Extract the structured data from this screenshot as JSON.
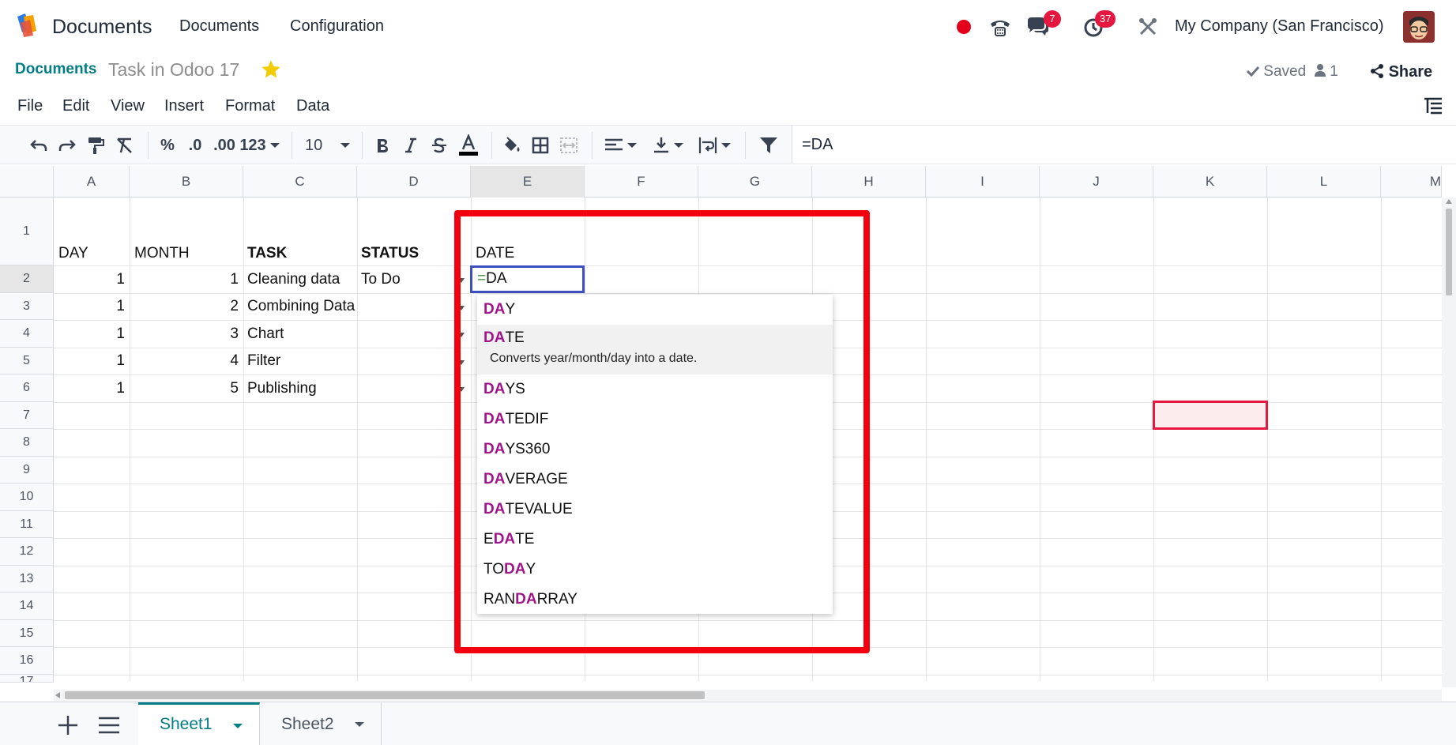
{
  "navbar": {
    "app_name": "Documents",
    "menu": [
      "Documents",
      "Configuration"
    ],
    "chat_badge": "7",
    "activity_badge": "37",
    "company": "My Company (San Francisco)"
  },
  "breadcrumb": {
    "parent": "Documents",
    "title": "Task in Odoo 17",
    "status": "Saved",
    "users": "1",
    "share": "Share"
  },
  "menubar": [
    "File",
    "Edit",
    "View",
    "Insert",
    "Format",
    "Data"
  ],
  "toolbar": {
    "percent": "%",
    "decrease_decimal": ".0",
    "increase_decimal": ".00",
    "number_format": "123",
    "font_size": "10",
    "formula_value": "=DA"
  },
  "columns": [
    "A",
    "B",
    "C",
    "D",
    "E",
    "F",
    "G",
    "H",
    "I",
    "J",
    "K",
    "L",
    "M"
  ],
  "rows": [
    "1",
    "2",
    "3",
    "4",
    "5",
    "6",
    "7",
    "8",
    "9",
    "10",
    "11",
    "12",
    "13",
    "14",
    "15",
    "16",
    "17"
  ],
  "cells": {
    "header": {
      "day": "DAY",
      "month": "MONTH",
      "task": "TASK",
      "status": "STATUS",
      "date": "DATE"
    },
    "data": [
      {
        "day": "1",
        "month": "1",
        "task": "Cleaning data",
        "status": "To Do"
      },
      {
        "day": "1",
        "month": "2",
        "task": "Combining Data",
        "status": ""
      },
      {
        "day": "1",
        "month": "3",
        "task": "Chart",
        "status": ""
      },
      {
        "day": "1",
        "month": "4",
        "task": "Filter",
        "status": ""
      },
      {
        "day": "1",
        "month": "5",
        "task": "Publishing",
        "status": ""
      }
    ],
    "editing": {
      "prefix": "=",
      "text": "DA"
    }
  },
  "autocomplete": [
    {
      "pre": "",
      "match": "DA",
      "post": "Y"
    },
    {
      "pre": "",
      "match": "DA",
      "post": "TE",
      "description": "Converts year/month/day into a date."
    },
    {
      "pre": "",
      "match": "DA",
      "post": "YS"
    },
    {
      "pre": "",
      "match": "DA",
      "post": "TEDIF"
    },
    {
      "pre": "",
      "match": "DA",
      "post": "YS360"
    },
    {
      "pre": "",
      "match": "DA",
      "post": "VERAGE"
    },
    {
      "pre": "",
      "match": "DA",
      "post": "TEVALUE"
    },
    {
      "pre": "E",
      "match": "DA",
      "post": "TE"
    },
    {
      "pre": "TO",
      "match": "DA",
      "post": "Y"
    },
    {
      "pre": "RAN",
      "match": "DA",
      "post": "RRAY"
    }
  ],
  "sheets": [
    "Sheet1",
    "Sheet2"
  ],
  "colors": {
    "brand": "#017e84",
    "badge": "#e5173f",
    "highlight": "#f3000f",
    "match": "#a0148a"
  }
}
